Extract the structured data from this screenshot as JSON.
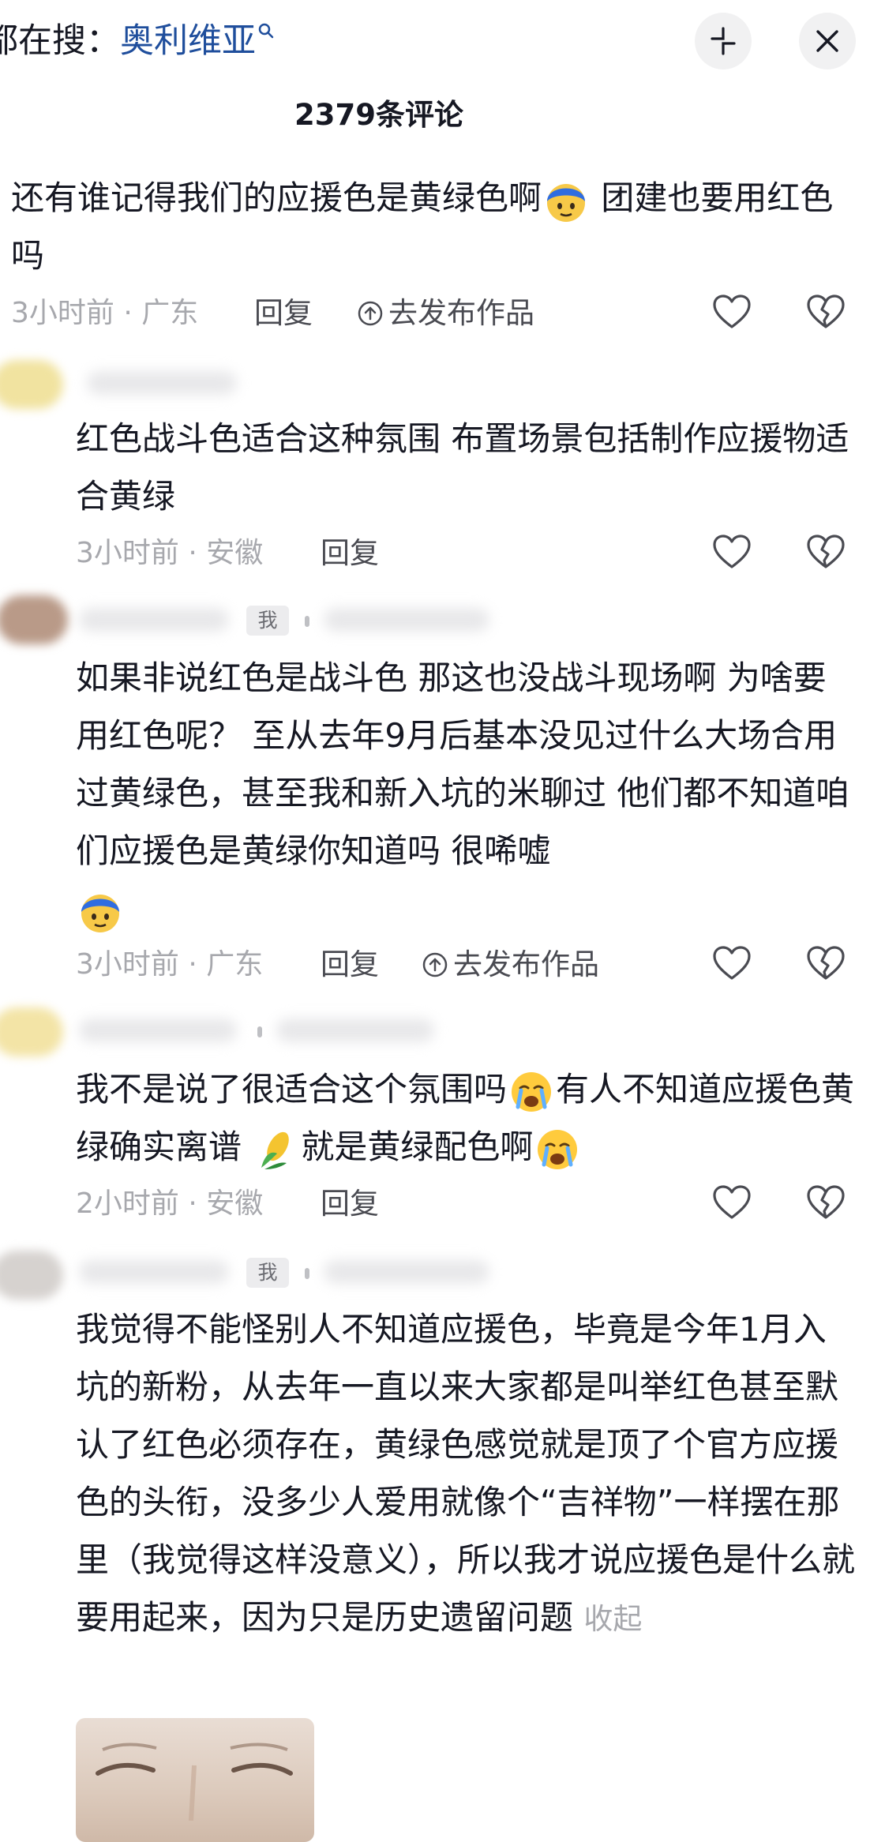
{
  "header": {
    "search_prefix": "都在搜：",
    "search_term": "奥利维亚",
    "comment_count_title": "2379条评论"
  },
  "comments": [
    {
      "text_a": "还有谁记得我们的应援色是黄绿色啊",
      "text_b": " 团建也要用红色吗",
      "time_location": "3小时前 · 广东",
      "reply_label": "回复",
      "publish_label": "去发布作品"
    },
    {
      "text": "红色战斗色适合这种氛围 布置场景包括制作应援物适合黄绿",
      "time_location": "3小时前 · 安徽",
      "reply_label": "回复"
    },
    {
      "author_badge": "我",
      "text": "如果非说红色是战斗色  那这也没战斗现场啊 为啥要用红色呢？ 至从去年9月后基本没见过什么大场合用过黄绿色，甚至我和新入坑的米聊过 他们都不知道咱们应援色是黄绿你知道吗 很唏嘘",
      "time_location": "3小时前 · 广东",
      "reply_label": "回复",
      "publish_label": "去发布作品"
    },
    {
      "text_a": "我不是说了很适合这个氛围吗",
      "text_b": "有人不知道应援色黄绿确实离谱 ",
      "text_c": "就是黄绿配色啊",
      "time_location": "2小时前 · 安徽",
      "reply_label": "回复"
    },
    {
      "author_badge": "我",
      "text": "我觉得不能怪别人不知道应援色，毕竟是今年1月入坑的新粉，从去年一直以来大家都是叫举红色甚至默认了红色必须存在，黄绿色感觉就是顶了个官方应援色的头衔，没多少人爱用就像个“吉祥物”一样摆在那里（我觉得这样没意义），所以我才说应援色是什么就要用起来，因为只是历史遗留问题",
      "collapse_label": "收起"
    }
  ],
  "icons": {
    "search": "magnifier-icon",
    "collapse": "collapse-arrows-icon",
    "close": "close-icon",
    "like": "heart-outline-icon",
    "dislike": "broken-heart-icon",
    "publish": "up-arrow-circle-icon",
    "emoji_blue": "blue-hair-face-emoji",
    "emoji_cry": "crying-face-emoji",
    "emoji_corn": "corn-emoji"
  },
  "colors": {
    "search_term": "#1f4e9c",
    "meta_text": "#a7a8ad",
    "body_text": "#161823"
  }
}
